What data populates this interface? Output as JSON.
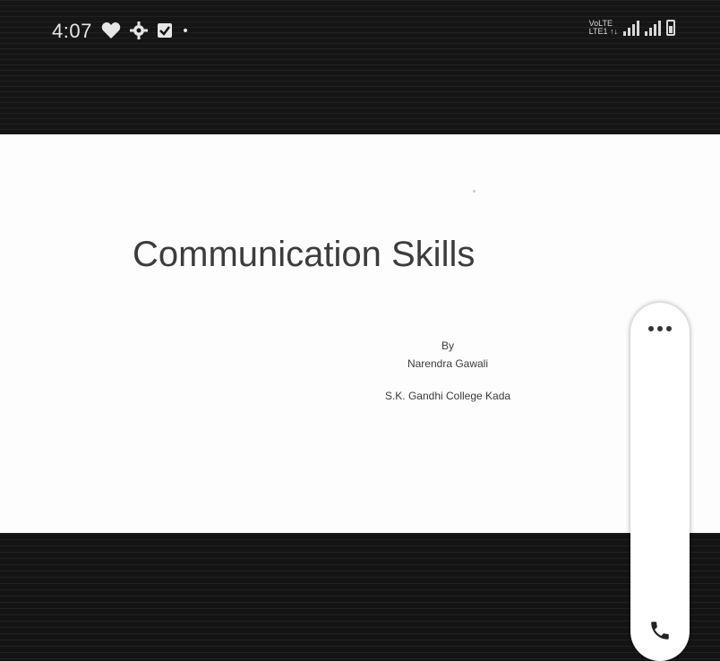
{
  "status_bar": {
    "time": "4:07",
    "icons": [
      "heart-icon",
      "settings-icon",
      "checkbox-icon",
      "dot"
    ],
    "network_label_top": "VoLTE",
    "network_label_bottom": "LTE1 ↑↓"
  },
  "slide": {
    "title": "Communication Skills",
    "by_label": "By",
    "author": "Narendra Gawali",
    "institution": "S.K. Gandhi College  Kada"
  },
  "side_panel": {
    "more_icon": "more-horizontal-icon",
    "call_icon": "phone-icon"
  },
  "colors": {
    "background": "#ffffff",
    "bars": "#151515",
    "title_text": "#3c3c3c"
  }
}
